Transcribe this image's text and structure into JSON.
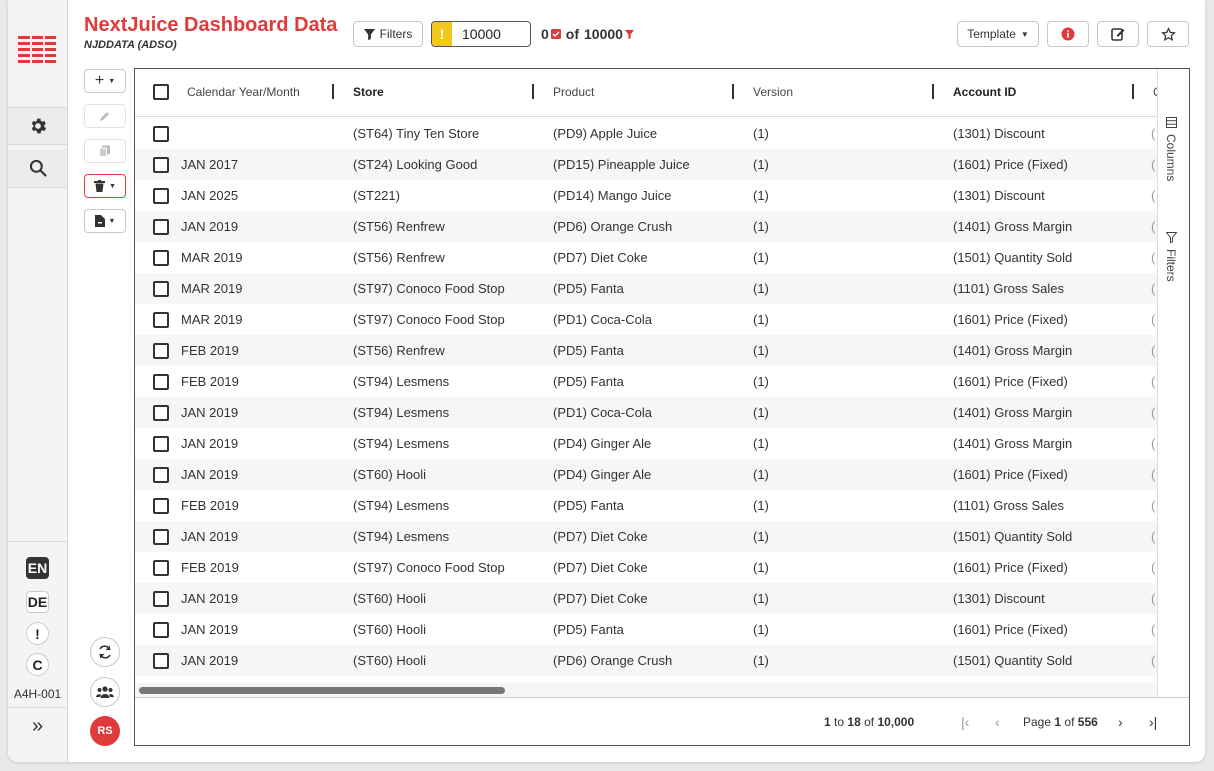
{
  "header": {
    "title": "NextJuice Dashboard Data",
    "subtitle": "NJDDATA (ADSO)",
    "filters_label": "Filters",
    "limit_value": "10000",
    "count_selected": "0",
    "count_total_prefix": "of",
    "count_total": "10000",
    "template_label": "Template"
  },
  "rail": {
    "languages": [
      "EN",
      "DE"
    ],
    "warning_symbol": "!",
    "c_symbol": "C",
    "code": "A4H-001",
    "expand_symbol": "»"
  },
  "user": {
    "initials": "RS"
  },
  "grid": {
    "columns": [
      "Calendar Year/Month",
      "Store",
      "Product",
      "Version",
      "Account ID",
      "C"
    ],
    "rows": [
      [
        "",
        "(ST64) Tiny Ten Store",
        "(PD9) Apple Juice",
        "(1)",
        "(1301) Discount"
      ],
      [
        "JAN 2017",
        "(ST24) Looking Good",
        "(PD15) Pineapple Juice",
        "(1)",
        "(1601) Price (Fixed)"
      ],
      [
        "JAN 2025",
        "(ST221)",
        "(PD14) Mango Juice",
        "(1)",
        "(1301) Discount"
      ],
      [
        "JAN 2019",
        "(ST56) Renfrew",
        "(PD6) Orange Crush",
        "(1)",
        "(1401) Gross Margin"
      ],
      [
        "MAR 2019",
        "(ST56) Renfrew",
        "(PD7) Diet Coke",
        "(1)",
        "(1501) Quantity Sold"
      ],
      [
        "MAR 2019",
        "(ST97) Conoco Food Stop",
        "(PD5) Fanta",
        "(1)",
        "(1101) Gross Sales"
      ],
      [
        "MAR 2019",
        "(ST97) Conoco Food Stop",
        "(PD1) Coca-Cola",
        "(1)",
        "(1601) Price (Fixed)"
      ],
      [
        "FEB 2019",
        "(ST56) Renfrew",
        "(PD5) Fanta",
        "(1)",
        "(1401) Gross Margin"
      ],
      [
        "FEB 2019",
        "(ST94) Lesmens",
        "(PD5) Fanta",
        "(1)",
        "(1601) Price (Fixed)"
      ],
      [
        "JAN 2019",
        "(ST94) Lesmens",
        "(PD1) Coca-Cola",
        "(1)",
        "(1401) Gross Margin"
      ],
      [
        "JAN 2019",
        "(ST94) Lesmens",
        "(PD4) Ginger Ale",
        "(1)",
        "(1401) Gross Margin"
      ],
      [
        "JAN 2019",
        "(ST60) Hooli",
        "(PD4) Ginger Ale",
        "(1)",
        "(1601) Price (Fixed)"
      ],
      [
        "FEB 2019",
        "(ST94) Lesmens",
        "(PD5) Fanta",
        "(1)",
        "(1101) Gross Sales"
      ],
      [
        "JAN 2019",
        "(ST94) Lesmens",
        "(PD7) Diet Coke",
        "(1)",
        "(1501) Quantity Sold"
      ],
      [
        "FEB 2019",
        "(ST97) Conoco Food Stop",
        "(PD7) Diet Coke",
        "(1)",
        "(1601) Price (Fixed)"
      ],
      [
        "JAN 2019",
        "(ST60) Hooli",
        "(PD7) Diet Coke",
        "(1)",
        "(1301) Discount"
      ],
      [
        "JAN 2019",
        "(ST60) Hooli",
        "(PD5) Fanta",
        "(1)",
        "(1601) Price (Fixed)"
      ],
      [
        "JAN 2019",
        "(ST60) Hooli",
        "(PD6) Orange Crush",
        "(1)",
        "(1501) Quantity Sold"
      ]
    ],
    "side_tabs": [
      "Columns",
      "Filters"
    ]
  },
  "footer": {
    "range_start": "1",
    "range_to": "to",
    "range_end": "18",
    "range_of": "of",
    "range_total": "10,000",
    "page_label": "Page",
    "page_current": "1",
    "page_of": "of",
    "page_total": "556"
  },
  "colors": {
    "accent": "#e03b3b",
    "warning": "#f2c81a"
  }
}
